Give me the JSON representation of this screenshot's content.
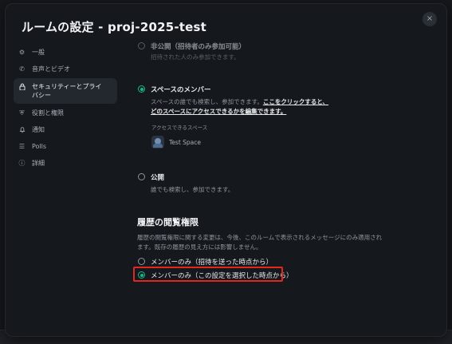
{
  "dialog": {
    "title": "ルームの設定 - proj-2025-test",
    "close_glyph": "×"
  },
  "sidebar": {
    "items": [
      {
        "label": "一般",
        "icon": "gear-icon",
        "glyph": "⚙"
      },
      {
        "label": "音声とビデオ",
        "icon": "phone-icon",
        "glyph": "✆"
      },
      {
        "label": "セキュリティーとプライ\nバシー",
        "icon": "lock-icon",
        "glyph": "🔒",
        "active": true
      },
      {
        "label": "役割と権限",
        "icon": "shield-icon",
        "glyph": "⛨"
      },
      {
        "label": "通知",
        "icon": "bell-icon",
        "glyph": "🔔"
      },
      {
        "label": "Polls",
        "icon": "poll-icon",
        "glyph": "☰"
      },
      {
        "label": "詳細",
        "icon": "info-icon",
        "glyph": "ⓘ"
      }
    ]
  },
  "access": {
    "private": {
      "label": "非公開（招待者のみ参加可能）",
      "desc": "招待された人のみ参加できます。"
    },
    "space_members": {
      "label": "スペースのメンバー",
      "desc_prefix": "スペースの誰でも検索し、参加できます。",
      "link1": "ここをクリックすると、",
      "link2": "どのスペースにアクセスできるかを編集できます。",
      "spaces_heading": "アクセスできるスペース",
      "space_name": "Test Space"
    },
    "public": {
      "label": "公開",
      "desc": "誰でも検索し、参加できます。"
    }
  },
  "history": {
    "title": "履歴の閲覧権限",
    "desc_line1": "履歴の閲覧権限に関する変更は、今後、このルームで表示されるメッセージにのみ適用され",
    "desc_line2": "ます。既存の履歴の見え方には影響しません。",
    "options": [
      {
        "label": "メンバーのみ（招待を送った時点から）",
        "checked": false
      },
      {
        "label": "メンバーのみ（この設定を選択した時点から）",
        "checked": true
      }
    ]
  },
  "colors": {
    "accent": "#0dbd8b",
    "highlight": "#e5261f"
  }
}
